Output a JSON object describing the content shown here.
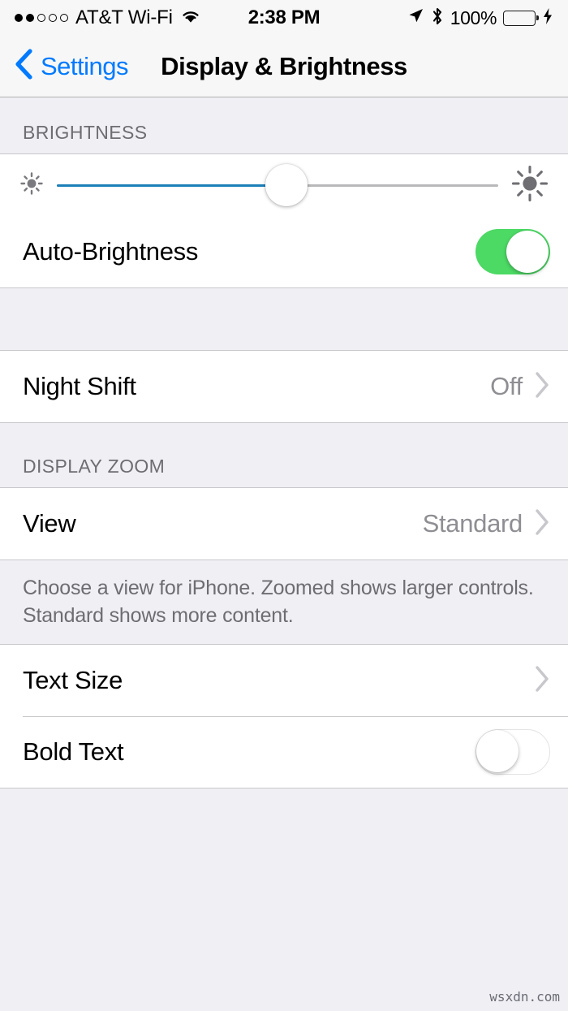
{
  "status_bar": {
    "signal_dots": {
      "filled": 2,
      "total": 5
    },
    "carrier": "AT&T Wi-Fi",
    "wifi_icon": "wifi-icon",
    "time": "2:38 PM",
    "location_icon": "location-arrow-icon",
    "bluetooth_icon": "bluetooth-icon",
    "battery_percent": "100%",
    "battery_level": 100,
    "battery_color": "#4CD964",
    "charging_icon": "lightning-bolt-icon"
  },
  "nav_bar": {
    "back_icon": "chevron-left-icon",
    "back_label": "Settings",
    "title": "Display & Brightness",
    "accent_color": "#007AFF"
  },
  "sections": {
    "brightness": {
      "header": "BRIGHTNESS",
      "slider": {
        "name": "brightness-slider",
        "value": 52,
        "min_icon": "sun-small-icon",
        "max_icon": "sun-large-icon",
        "fill_color": "#1C7FB8",
        "track_color": "#B9B9BB"
      },
      "auto_brightness": {
        "label": "Auto-Brightness",
        "toggle_state": "on",
        "toggle_color": "#4CD964"
      }
    },
    "night_shift": {
      "label": "Night Shift",
      "value": "Off",
      "chevron_icon": "chevron-right-icon"
    },
    "display_zoom": {
      "header": "DISPLAY ZOOM",
      "view": {
        "label": "View",
        "value": "Standard",
        "chevron_icon": "chevron-right-icon"
      },
      "footer_note": "Choose a view for iPhone. Zoomed shows larger controls. Standard shows more content."
    },
    "text": {
      "text_size": {
        "label": "Text Size",
        "chevron_icon": "chevron-right-icon"
      },
      "bold_text": {
        "label": "Bold Text",
        "toggle_state": "off"
      }
    }
  },
  "watermark": "wsxdn.com"
}
